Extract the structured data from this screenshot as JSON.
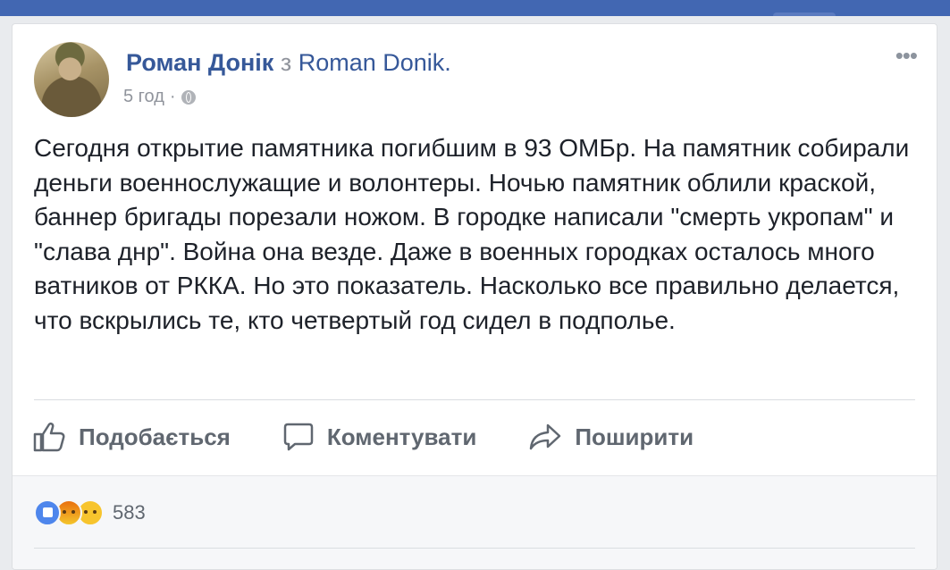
{
  "post": {
    "author": {
      "name": "Роман Донік",
      "via": "з",
      "page": "Roman Donik."
    },
    "time": "5 год",
    "separator": "·",
    "privacy_icon": "globe-icon",
    "menu_icon": "more-icon",
    "text": "Сегодня открытие памятника погибшим в 93 ОМБр. На памятник собирали деньги военнослужащие и волонтеры. Ночью памятник облили краской, баннер бригады порезали ножом. В городке написали \"смерть укропам\" и \"слава днр\". Война она везде. Даже в военных городках осталось много ватников от РККА. Но это показатель. Насколько все правильно делается, что вскрылись те, кто четвертый год сидел в подполье."
  },
  "actions": {
    "like": "Подобається",
    "comment": "Коментувати",
    "share": "Поширити"
  },
  "reactions": {
    "icons": [
      "like-reaction-icon",
      "angry-reaction-icon",
      "sad-reaction-icon"
    ],
    "count": "583"
  },
  "colors": {
    "topbar": "#4267b2",
    "link": "#365899",
    "text": "#1d2129",
    "muted": "#90949c",
    "action": "#606770"
  }
}
